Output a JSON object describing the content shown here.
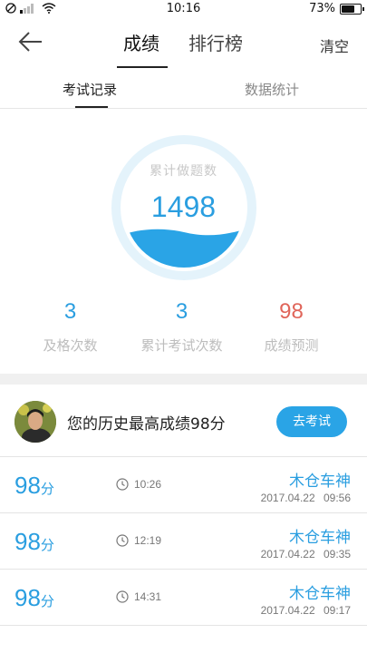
{
  "status_bar": {
    "time": "10:16",
    "battery": "73%",
    "battery_level": 0.73
  },
  "nav": {
    "tab_score": "成绩",
    "tab_rank": "排行榜",
    "clear": "清空"
  },
  "subtabs": {
    "records": "考试记录",
    "stats": "数据统计"
  },
  "gauge": {
    "label": "累计做题数",
    "value": "1498"
  },
  "stats": [
    {
      "value": "3",
      "label": "及格次数",
      "color": "#2a9ee0"
    },
    {
      "value": "3",
      "label": "累计考试次数",
      "color": "#2a9ee0"
    },
    {
      "value": "98",
      "label": "成绩预测",
      "color": "#e0655a"
    }
  ],
  "best": {
    "text": "您的历史最高成绩98分",
    "button": "去考试"
  },
  "records": [
    {
      "score": "98",
      "unit": "分",
      "duration": "10:26",
      "name": "木仓车神",
      "date": "2017.04.22",
      "clock": "09:56"
    },
    {
      "score": "98",
      "unit": "分",
      "duration": "12:19",
      "name": "木仓车神",
      "date": "2017.04.22",
      "clock": "09:35"
    },
    {
      "score": "98",
      "unit": "分",
      "duration": "14:31",
      "name": "木仓车神",
      "date": "2017.04.22",
      "clock": "09:17"
    }
  ],
  "colors": {
    "accent": "#2a9ee0",
    "button": "#2aa4e6",
    "prediction": "#e0655a",
    "gauge_ring": "#e4f3fb",
    "gauge_water": "#2aa4e6"
  },
  "icons": {
    "back": "back-arrow-icon",
    "clock": "clock-icon",
    "wifi": "wifi-icon",
    "battery": "battery-icon"
  }
}
